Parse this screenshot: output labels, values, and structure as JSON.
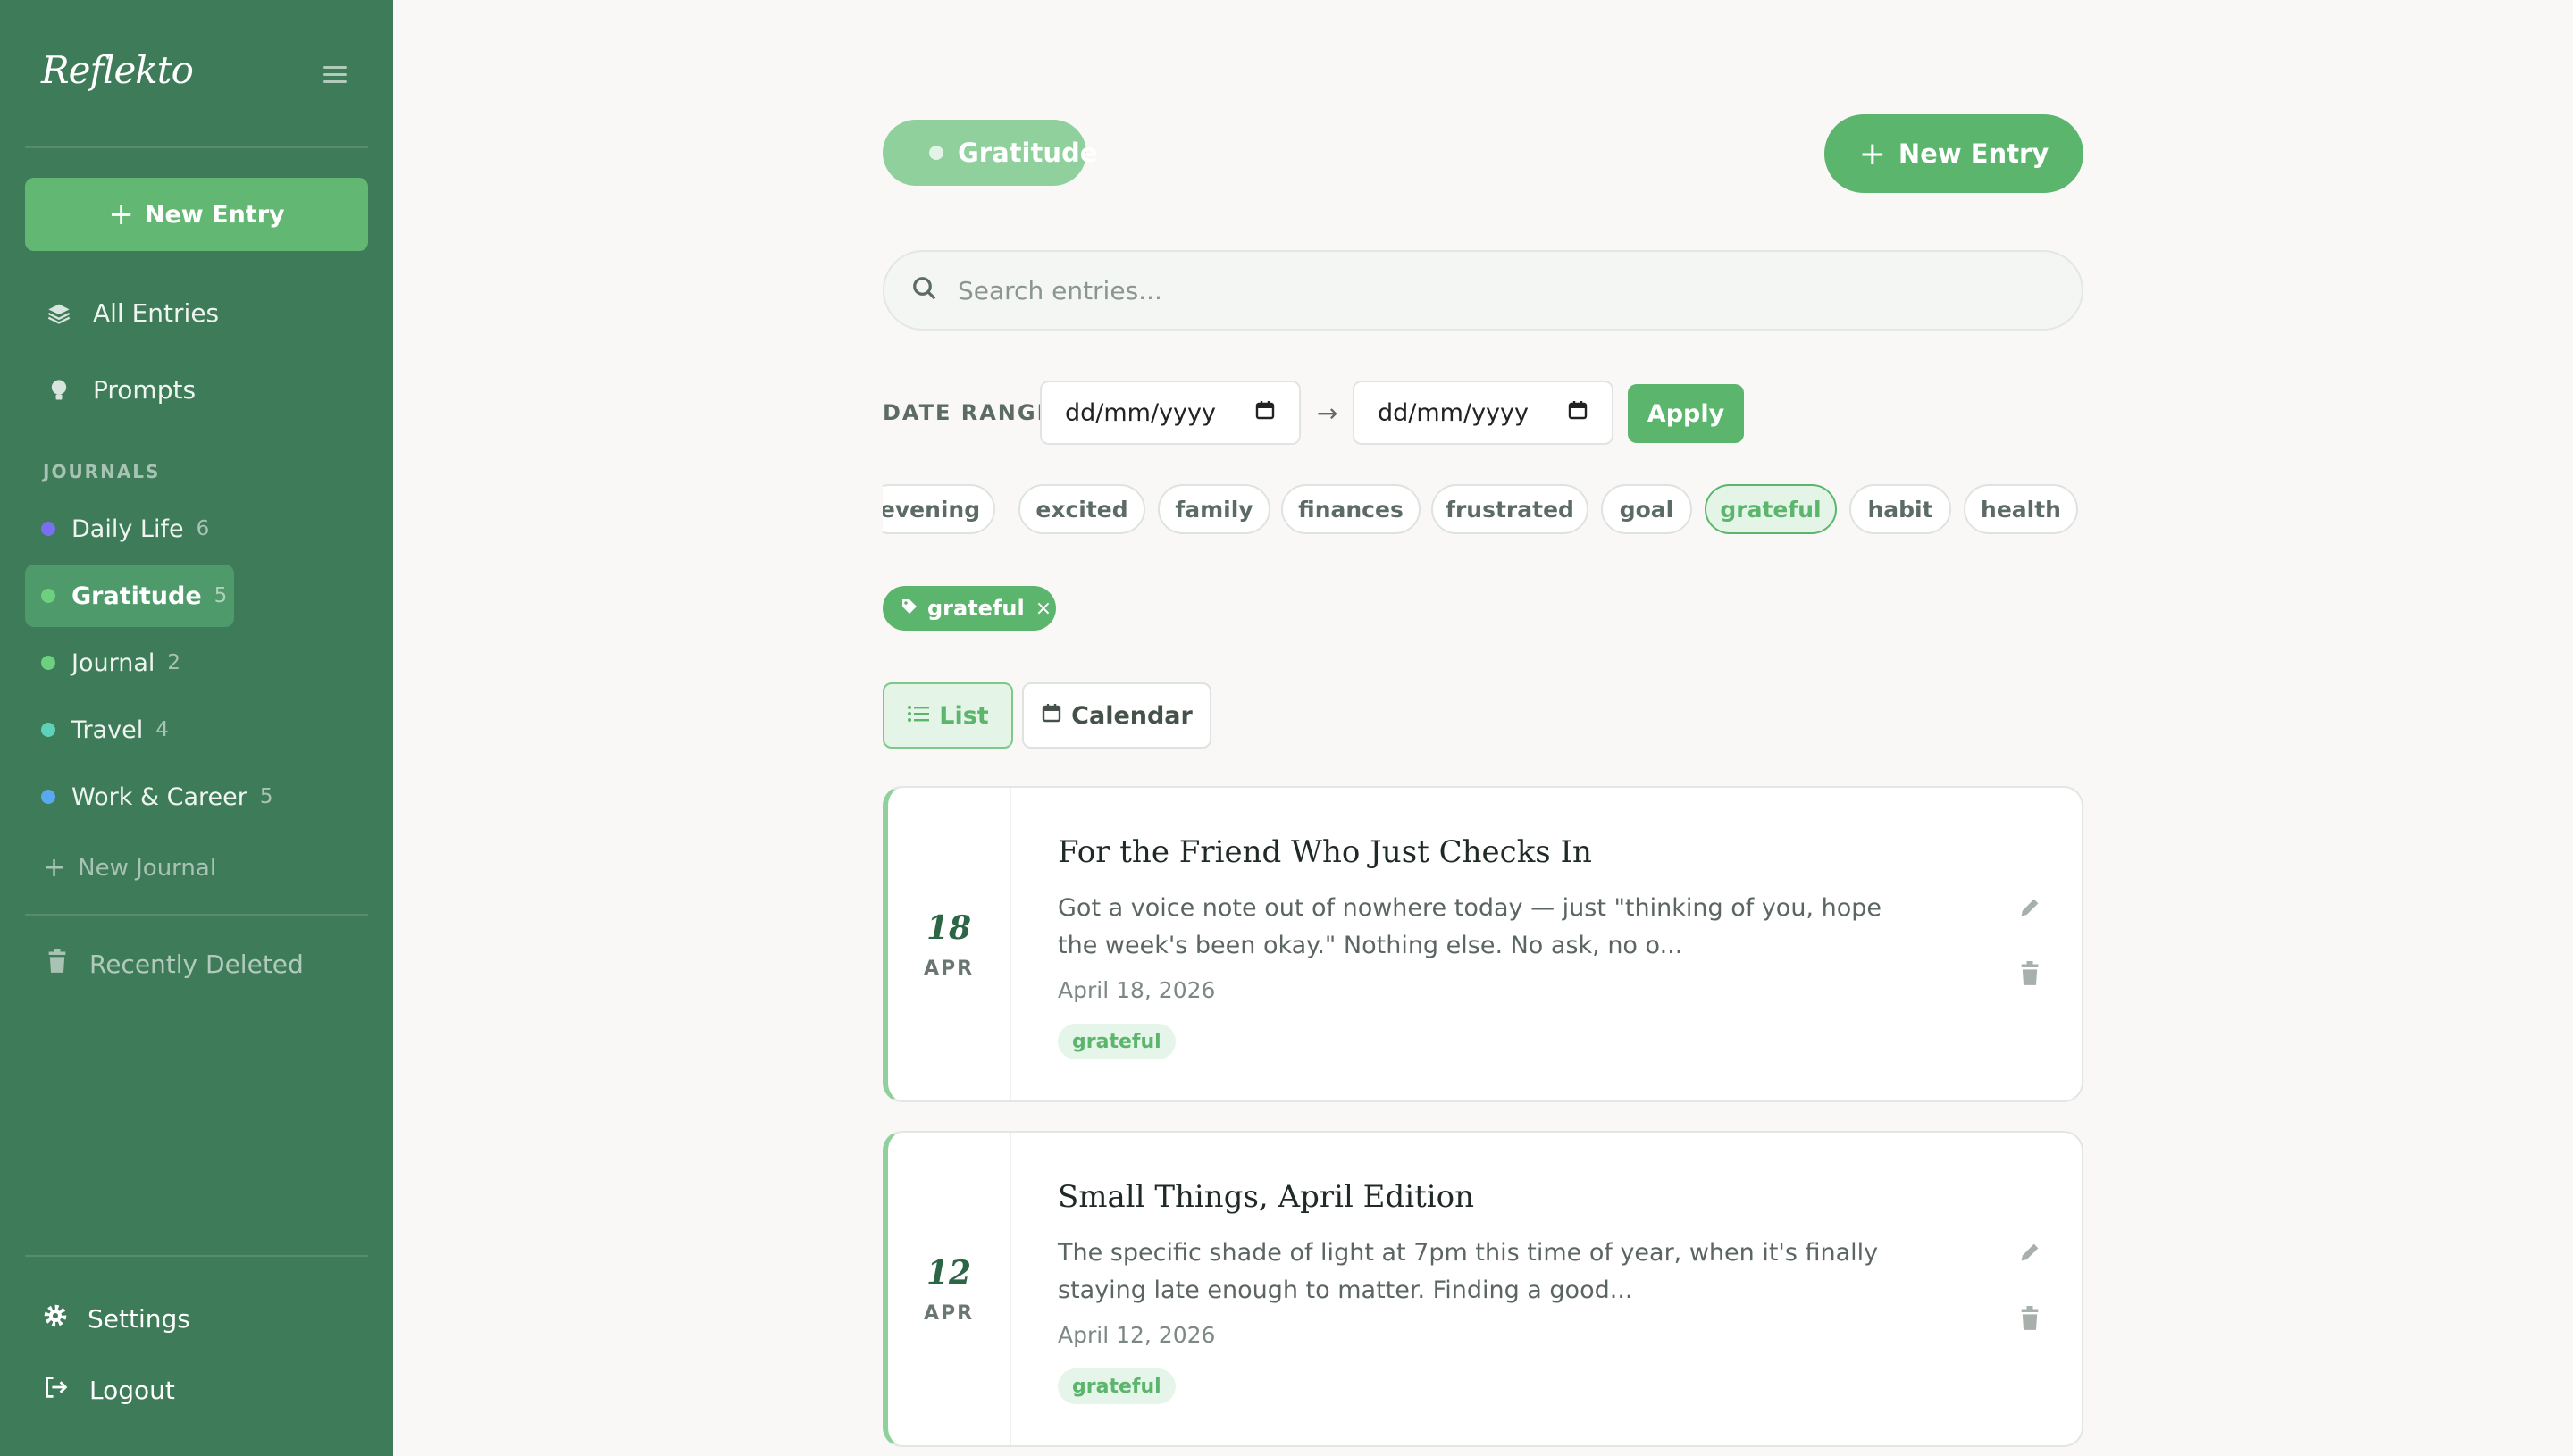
{
  "app": {
    "logo": "Reflekto"
  },
  "sidebar": {
    "new_entry_label": "New Entry",
    "nav": [
      {
        "label": "All Entries",
        "icon": "layers-icon"
      },
      {
        "label": "Prompts",
        "icon": "lightbulb-icon"
      }
    ],
    "journals_heading": "JOURNALS",
    "journals": [
      {
        "name": "Daily Life",
        "count": "6",
        "color": "#7a6ff0"
      },
      {
        "name": "Gratitude",
        "count": "5",
        "color": "#6cd07f",
        "active": true
      },
      {
        "name": "Journal",
        "count": "2",
        "color": "#6cd07f"
      },
      {
        "name": "Travel",
        "count": "4",
        "color": "#5ed1b8"
      },
      {
        "name": "Work & Career",
        "count": "5",
        "color": "#5aa8f0"
      }
    ],
    "new_journal_label": "New Journal",
    "recently_deleted_label": "Recently Deleted",
    "settings_label": "Settings",
    "logout_label": "Logout"
  },
  "main": {
    "journal_pill": "Gratitude",
    "new_entry_label": "New Entry",
    "search_placeholder": "Search entries...",
    "date_range_label": "DATE RANGE",
    "date_from_placeholder": "dd/mm/yyyy",
    "date_to_placeholder": "dd/mm/yyyy",
    "apply_label": "Apply",
    "tags": [
      "evening",
      "excited",
      "family",
      "finances",
      "frustrated",
      "goal",
      "grateful",
      "habit",
      "health"
    ],
    "active_tag": "grateful",
    "active_filter": "grateful",
    "view_list_label": "List",
    "view_calendar_label": "Calendar",
    "entries": [
      {
        "day": "18",
        "month": "APR",
        "title": "For the Friend Who Just Checks In",
        "excerpt": "Got a voice note out of nowhere today — just \"thinking of you, hope the week's been okay.\" Nothing else. No ask, no o...",
        "date": "April 18, 2026",
        "tag": "grateful"
      },
      {
        "day": "12",
        "month": "APR",
        "title": "Small Things, April Edition",
        "excerpt": "The specific shade of light at 7pm this time of year, when it's finally staying late enough to matter. Finding a good...",
        "date": "April 12, 2026",
        "tag": "grateful"
      }
    ]
  },
  "colors": {
    "sidebar_bg": "#3e7b58",
    "accent": "#5cb56c",
    "accent_light": "#8fd09c"
  }
}
